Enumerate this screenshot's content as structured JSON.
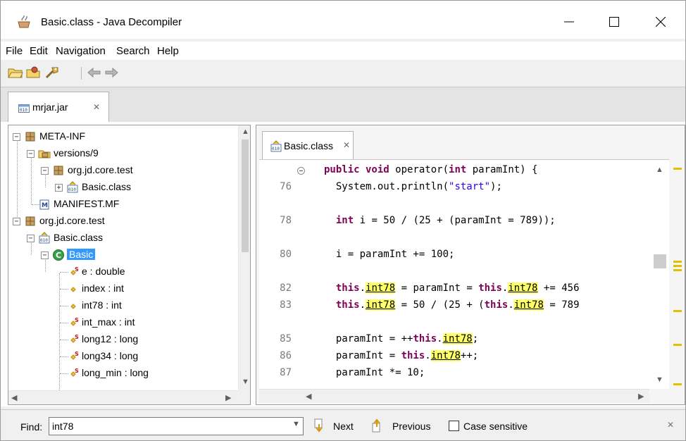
{
  "window": {
    "title": "Basic.class - Java Decompiler"
  },
  "menu": [
    "File",
    "Edit",
    "Navigation",
    "Search",
    "Help"
  ],
  "toolbar": {
    "buttons": [
      "open-folder-icon",
      "open-type-icon",
      "search-icon",
      "back-arrow-icon",
      "forward-arrow-icon"
    ]
  },
  "outer_tab": {
    "label": "mrjar.jar"
  },
  "tree": {
    "nodes": [
      {
        "label": "META-INF",
        "icon": "package-icon"
      },
      {
        "label": "versions/9",
        "icon": "folder-package-icon"
      },
      {
        "label": "org.jd.core.test",
        "icon": "package-icon"
      },
      {
        "label": "Basic.class",
        "icon": "class-file-icon"
      },
      {
        "label": "MANIFEST.MF",
        "icon": "manifest-icon"
      },
      {
        "label": "org.jd.core.test",
        "icon": "package-icon"
      },
      {
        "label": "Basic.class",
        "icon": "class-file-icon"
      },
      {
        "label": "Basic",
        "icon": "class-icon"
      },
      {
        "label": "e : double",
        "icon": "static-field-icon"
      },
      {
        "label": "index : int",
        "icon": "field-icon"
      },
      {
        "label": "int78 : int",
        "icon": "field-icon"
      },
      {
        "label": "int_max : int",
        "icon": "static-field-icon"
      },
      {
        "label": "long12 : long",
        "icon": "static-field-icon"
      },
      {
        "label": "long34 : long",
        "icon": "static-field-icon"
      },
      {
        "label": "long_min : long",
        "icon": "static-field-icon"
      }
    ],
    "selected": "Basic"
  },
  "editor": {
    "tab_label": "Basic.class",
    "lines": [
      {
        "ln": "",
        "code": "public void operator(int paramInt) {"
      },
      {
        "ln": "76",
        "code": "System.out.println(\"start\");"
      },
      {
        "ln": "",
        "code": ""
      },
      {
        "ln": "78",
        "code": "int i = 50 / (25 + (paramInt = 789));"
      },
      {
        "ln": "",
        "code": ""
      },
      {
        "ln": "80",
        "code": "i = paramInt += 100;"
      },
      {
        "ln": "",
        "code": ""
      },
      {
        "ln": "82",
        "code": "this.int78 = paramInt = this.int78 += 456"
      },
      {
        "ln": "83",
        "code": "this.int78 = 50 / (25 + (this.int78 = 789"
      },
      {
        "ln": "",
        "code": ""
      },
      {
        "ln": "85",
        "code": "paramInt = ++this.int78;"
      },
      {
        "ln": "86",
        "code": "paramInt = this.int78++;"
      },
      {
        "ln": "87",
        "code": "paramInt *= 10;"
      }
    ]
  },
  "find": {
    "label": "Find:",
    "value": "int78",
    "next": "Next",
    "previous": "Previous",
    "case_sensitive": "Case sensitive",
    "case_checked": false
  },
  "colors": {
    "keyword": "#7f0055",
    "string": "#2a00ff",
    "highlight": "#ffff66",
    "selection": "#3399ff"
  }
}
